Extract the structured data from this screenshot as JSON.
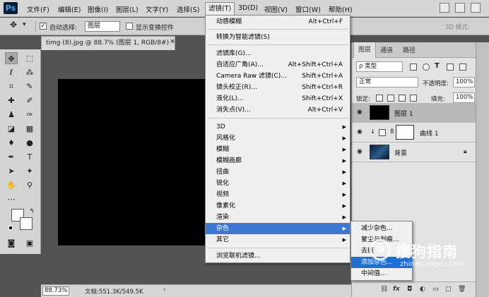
{
  "app": {
    "logo": "Ps"
  },
  "menubar": {
    "items": [
      "文件(F)",
      "编辑(E)",
      "图像(I)",
      "图层(L)",
      "文字(Y)",
      "选择(S)",
      "滤镜(T)",
      "3D(D)",
      "视图(V)",
      "窗口(W)",
      "帮助(H)"
    ]
  },
  "options": {
    "auto_select_label": "自动选择:",
    "auto_select_checked": "✓",
    "auto_select_target": "图层",
    "show_transform_label": "显示变换控件",
    "mode_3d_label": "3D 模式:"
  },
  "document": {
    "tab_title": "timg (8).jpg @ 88.7% (图层 1, RGB/8#) *",
    "close_glyph": "×"
  },
  "status": {
    "zoom": "88.73%",
    "doc_info": "文档:551.3K/549.5K",
    "arrow": "›"
  },
  "filter_menu": {
    "items": [
      {
        "label": "动感模糊",
        "shortcut": "Alt+Ctrl+F"
      },
      {
        "label": "转换为智能滤镜(S)",
        "shortcut": ""
      },
      {
        "label": "滤镜库(G)...",
        "shortcut": ""
      },
      {
        "label": "自适应广角(A)...",
        "shortcut": "Alt+Shift+Ctrl+A"
      },
      {
        "label": "Camera Raw 滤镜(C)...",
        "shortcut": "Shift+Ctrl+A"
      },
      {
        "label": "镜头校正(R)...",
        "shortcut": "Shift+Ctrl+R"
      },
      {
        "label": "液化(L)...",
        "shortcut": "Shift+Ctrl+X"
      },
      {
        "label": "消失点(V)...",
        "shortcut": "Alt+Ctrl+V"
      },
      {
        "label": "3D",
        "shortcut": ""
      },
      {
        "label": "风格化",
        "shortcut": ""
      },
      {
        "label": "模糊",
        "shortcut": ""
      },
      {
        "label": "模糊画廊",
        "shortcut": ""
      },
      {
        "label": "扭曲",
        "shortcut": ""
      },
      {
        "label": "锐化",
        "shortcut": ""
      },
      {
        "label": "视频",
        "shortcut": ""
      },
      {
        "label": "像素化",
        "shortcut": ""
      },
      {
        "label": "渲染",
        "shortcut": ""
      },
      {
        "label": "杂色",
        "shortcut": ""
      },
      {
        "label": "其它",
        "shortcut": ""
      },
      {
        "label": "浏览联机滤镜...",
        "shortcut": ""
      }
    ]
  },
  "noise_submenu": {
    "items": [
      "减少杂色...",
      "蒙尘与划痕...",
      "去斑",
      "添加杂色...",
      "中间值..."
    ]
  },
  "panels": {
    "tabs": [
      "图层",
      "通道",
      "路径"
    ],
    "filter_kind": "ρ 类型",
    "blend_mode": "正常",
    "opacity_label": "不透明度:",
    "opacity_value": "100%",
    "lock_label": "锁定:",
    "fill_label": "填充:",
    "fill_value": "100%",
    "layers": [
      {
        "name": "图层 1"
      },
      {
        "name": "曲线 1"
      },
      {
        "name": "背景"
      }
    ],
    "bottom_icons": [
      "fx"
    ]
  },
  "watermark": {
    "text": "搜狗指南",
    "glyph": "S",
    "url": "zhinan.sogou.com"
  }
}
